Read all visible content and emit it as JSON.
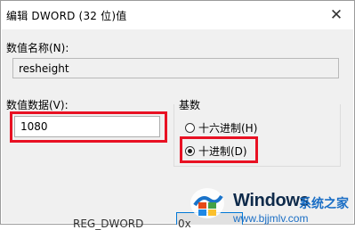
{
  "dialog": {
    "title": "编辑 DWORD (32 位)值",
    "close_glyph": "✕",
    "value_name_label": "数值名称(N):",
    "value_name": "resheight",
    "value_data_label": "数值数据(V):",
    "value_data": "1080",
    "base_group_label": "基数",
    "base_options": [
      {
        "label": "十六进制(H)",
        "checked": false
      },
      {
        "label": "十进制(D)",
        "checked": true
      }
    ]
  },
  "behind": {
    "type_text": "REG_DWORD",
    "value_fragment": "0x"
  },
  "watermark": {
    "brand": "Windows",
    "site_name": "系统之家",
    "url": "www.bjjmlv.com"
  },
  "colors": {
    "highlight_red": "#e81123",
    "logo_blue": "#0078d7"
  }
}
